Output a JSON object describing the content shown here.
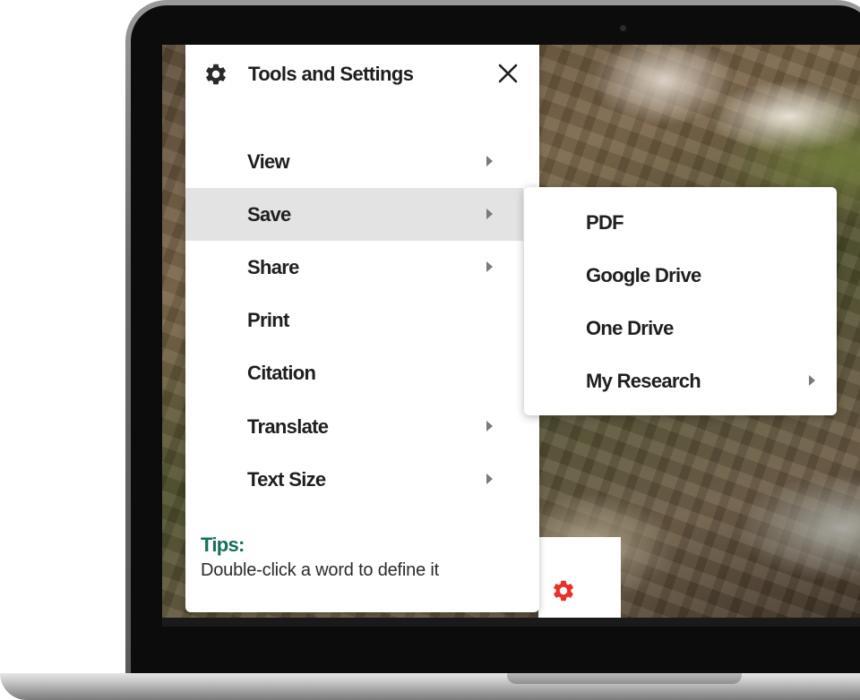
{
  "menu": {
    "title": "Tools and Settings",
    "items": [
      {
        "label": "View",
        "has_submenu": true
      },
      {
        "label": "Save",
        "has_submenu": true,
        "active": true
      },
      {
        "label": "Share",
        "has_submenu": true
      },
      {
        "label": "Print",
        "has_submenu": false
      },
      {
        "label": "Citation",
        "has_submenu": false
      },
      {
        "label": "Translate",
        "has_submenu": true
      },
      {
        "label": "Text Size",
        "has_submenu": true
      }
    ]
  },
  "submenu": {
    "items": [
      {
        "label": "PDF",
        "has_submenu": false
      },
      {
        "label": "Google Drive",
        "has_submenu": false
      },
      {
        "label": "One Drive",
        "has_submenu": false
      },
      {
        "label": "My Research",
        "has_submenu": true
      }
    ]
  },
  "tips": {
    "title": "Tips:",
    "text": "Double-click a word to define it"
  },
  "icons": {
    "settings": "gear-icon",
    "close": "close-icon",
    "submenu": "caret-right-icon"
  },
  "colors": {
    "tips_title": "#16705a",
    "gear_accent": "#e8312a",
    "active_item_bg": "#e3e3e3"
  }
}
